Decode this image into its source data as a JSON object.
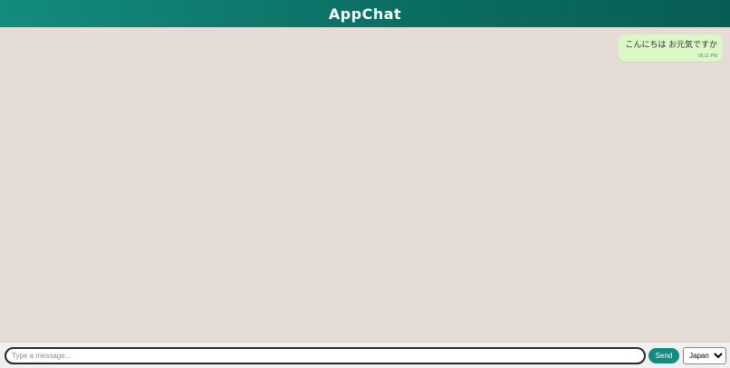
{
  "header": {
    "title": "AppChat"
  },
  "messages": [
    {
      "text": "こんにちは お元気ですか",
      "time": "06:11 PM",
      "direction": "outgoing"
    }
  ],
  "composer": {
    "placeholder": "Type a message...",
    "value": "",
    "send_label": "Send",
    "language": {
      "selected": "Japanese",
      "options": [
        "Japanese"
      ]
    }
  },
  "colors": {
    "header_gradient_start": "#128c7e",
    "header_gradient_end": "#075e54",
    "chat_background": "#e5ddd5",
    "outgoing_bubble": "#dcf8c6",
    "send_button": "#128c7e"
  }
}
